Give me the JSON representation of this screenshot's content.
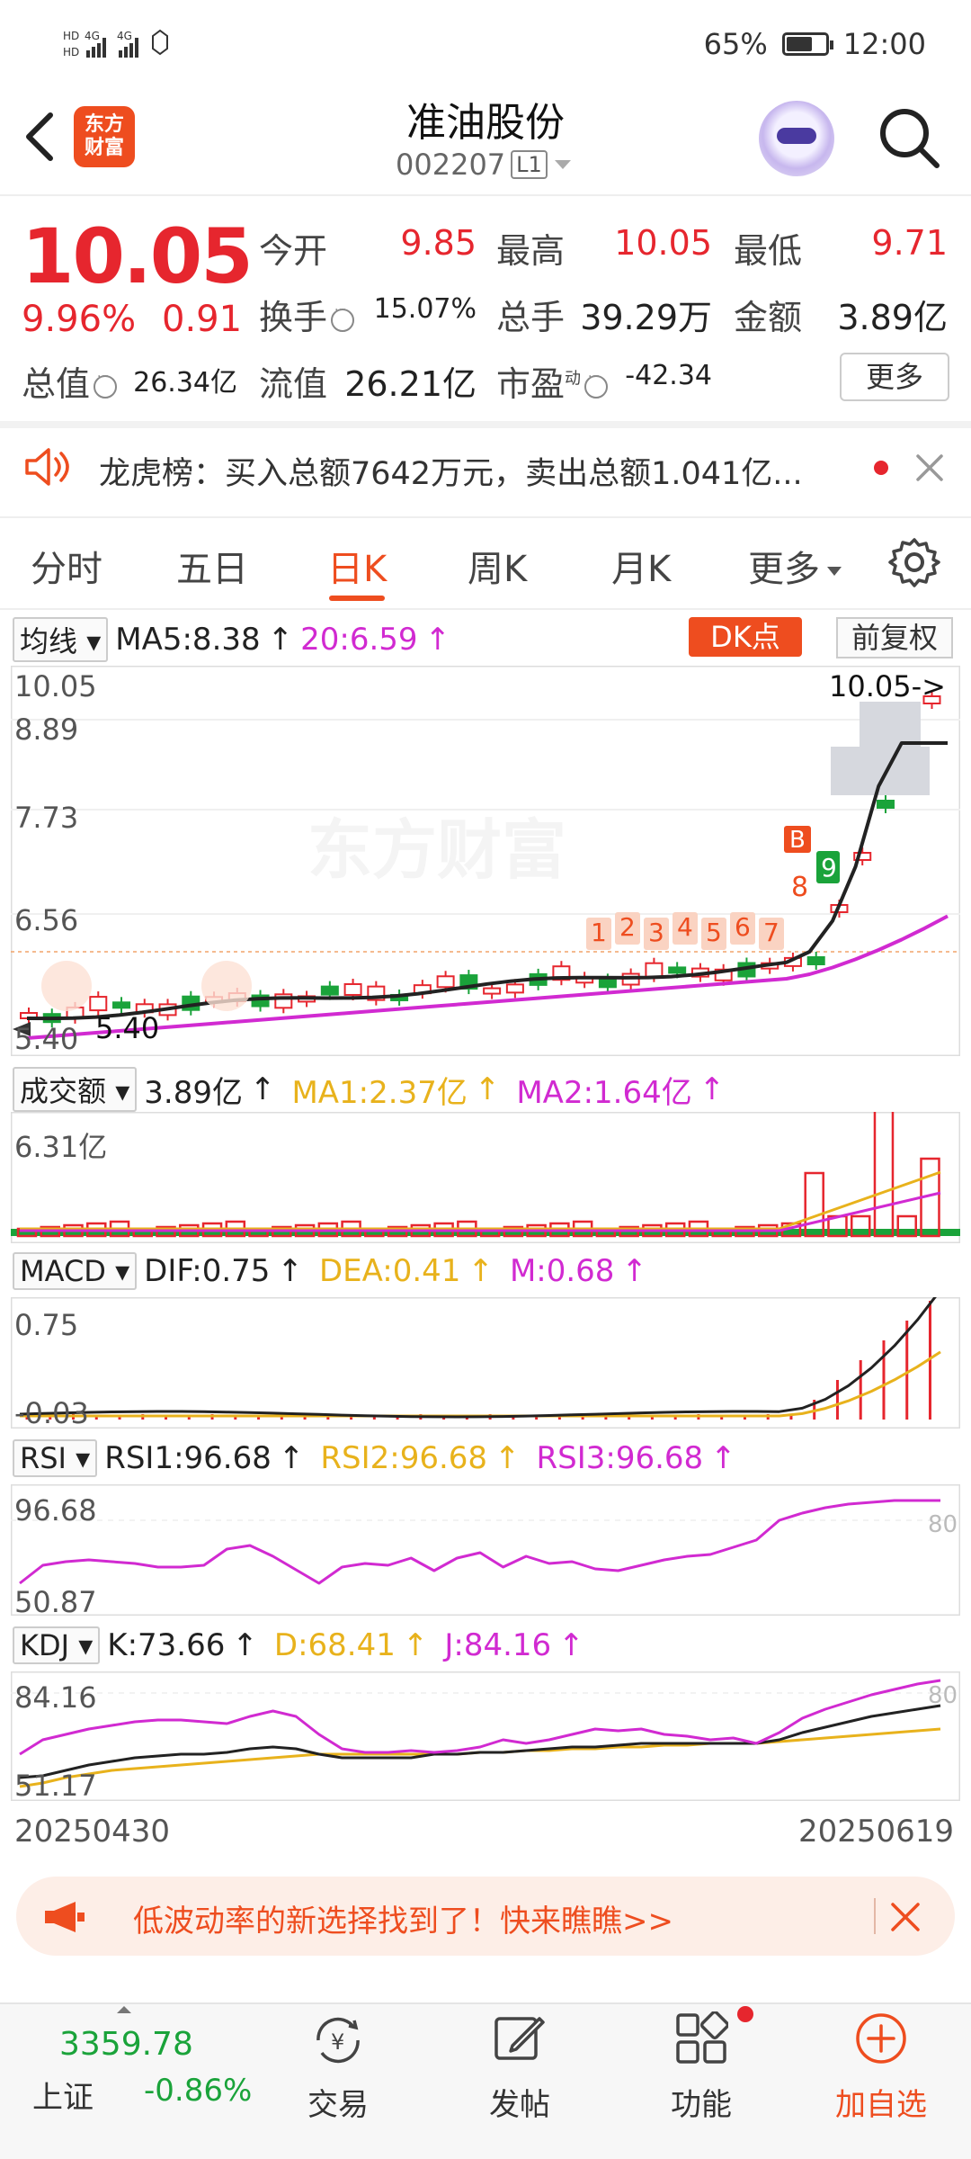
{
  "status_bar": {
    "network_labels": [
      "HD",
      "4G",
      "HD",
      "4G"
    ],
    "battery": "65%",
    "time": "12:00"
  },
  "header": {
    "logo_text": "东方财富",
    "stock_name": "准油股份",
    "stock_code": "002207",
    "level": "L1"
  },
  "quote": {
    "price": "10.05",
    "change_pct": "9.96%",
    "change_amt": "0.91",
    "open_label": "今开",
    "open": "9.85",
    "high_label": "最高",
    "high": "10.05",
    "low_label": "最低",
    "low": "9.71",
    "turnover_label": "换手",
    "turnover": "15.07%",
    "volume_label": "总手",
    "volume": "39.29万",
    "amount_label": "金额",
    "amount": "3.89亿",
    "mktcap_label": "总值",
    "mktcap": "26.34亿",
    "float_label": "流值",
    "float_cap": "26.21亿",
    "pe_label": "市盈",
    "pe_sup": "动",
    "pe": "-42.34",
    "more": "更多"
  },
  "notice": {
    "text": "龙虎榜：买入总额7642万元，卖出总额1.041亿..."
  },
  "tabs": [
    "分时",
    "五日",
    "日K",
    "周K",
    "月K",
    "更多"
  ],
  "active_tab": 2,
  "ma_row": {
    "selector": "均线",
    "ma5": "MA5:8.38",
    "ma20": "20:6.59",
    "dk_label": "DK点",
    "adjust_label": "前复权"
  },
  "kline": {
    "y_labels": [
      "10.05",
      "8.89",
      "7.73",
      "6.56",
      "5.40"
    ],
    "last_price_tag": "10.05->",
    "min_tag": "5.40",
    "signal_numbers": [
      "1",
      "2",
      "3",
      "4",
      "5",
      "6",
      "7",
      "8",
      "9"
    ],
    "buy_marker": "B",
    "watermark": "东方财富"
  },
  "volume_row": {
    "selector": "成交额",
    "value": "3.89亿",
    "ma1": "MA1:2.37亿",
    "ma2": "MA2:1.64亿",
    "y_label": "6.31亿"
  },
  "macd_row": {
    "selector": "MACD",
    "dif": "DIF:0.75",
    "dea": "DEA:0.41",
    "m": "M:0.68",
    "y_top": "0.75",
    "y_bottom": "-0.03"
  },
  "rsi_row": {
    "selector": "RSI",
    "rsi1": "RSI1:96.68",
    "rsi2": "RSI2:96.68",
    "rsi3": "RSI3:96.68",
    "y_top": "96.68",
    "y_bottom": "50.87",
    "ref": "80"
  },
  "kdj_row": {
    "selector": "KDJ",
    "k": "K:73.66",
    "d": "D:68.41",
    "j": "J:84.16",
    "y_top": "84.16",
    "y_bottom": "51.17",
    "ref": "80"
  },
  "date_axis": {
    "start": "20250430",
    "end": "20250619"
  },
  "banner": {
    "text": "低波动率的新选择找到了！快来瞧瞧>>"
  },
  "bottom_nav": {
    "index_value": "3359.78",
    "index_name": "上证",
    "index_change": "-0.86%",
    "items": [
      "交易",
      "发帖",
      "功能",
      "加自选"
    ]
  },
  "colors": {
    "up": "#e6262e",
    "down": "#1aa33a",
    "accent": "#ee4d1f",
    "ma_yellow": "#e8b21c",
    "ma_magenta": "#d12ad1"
  }
}
